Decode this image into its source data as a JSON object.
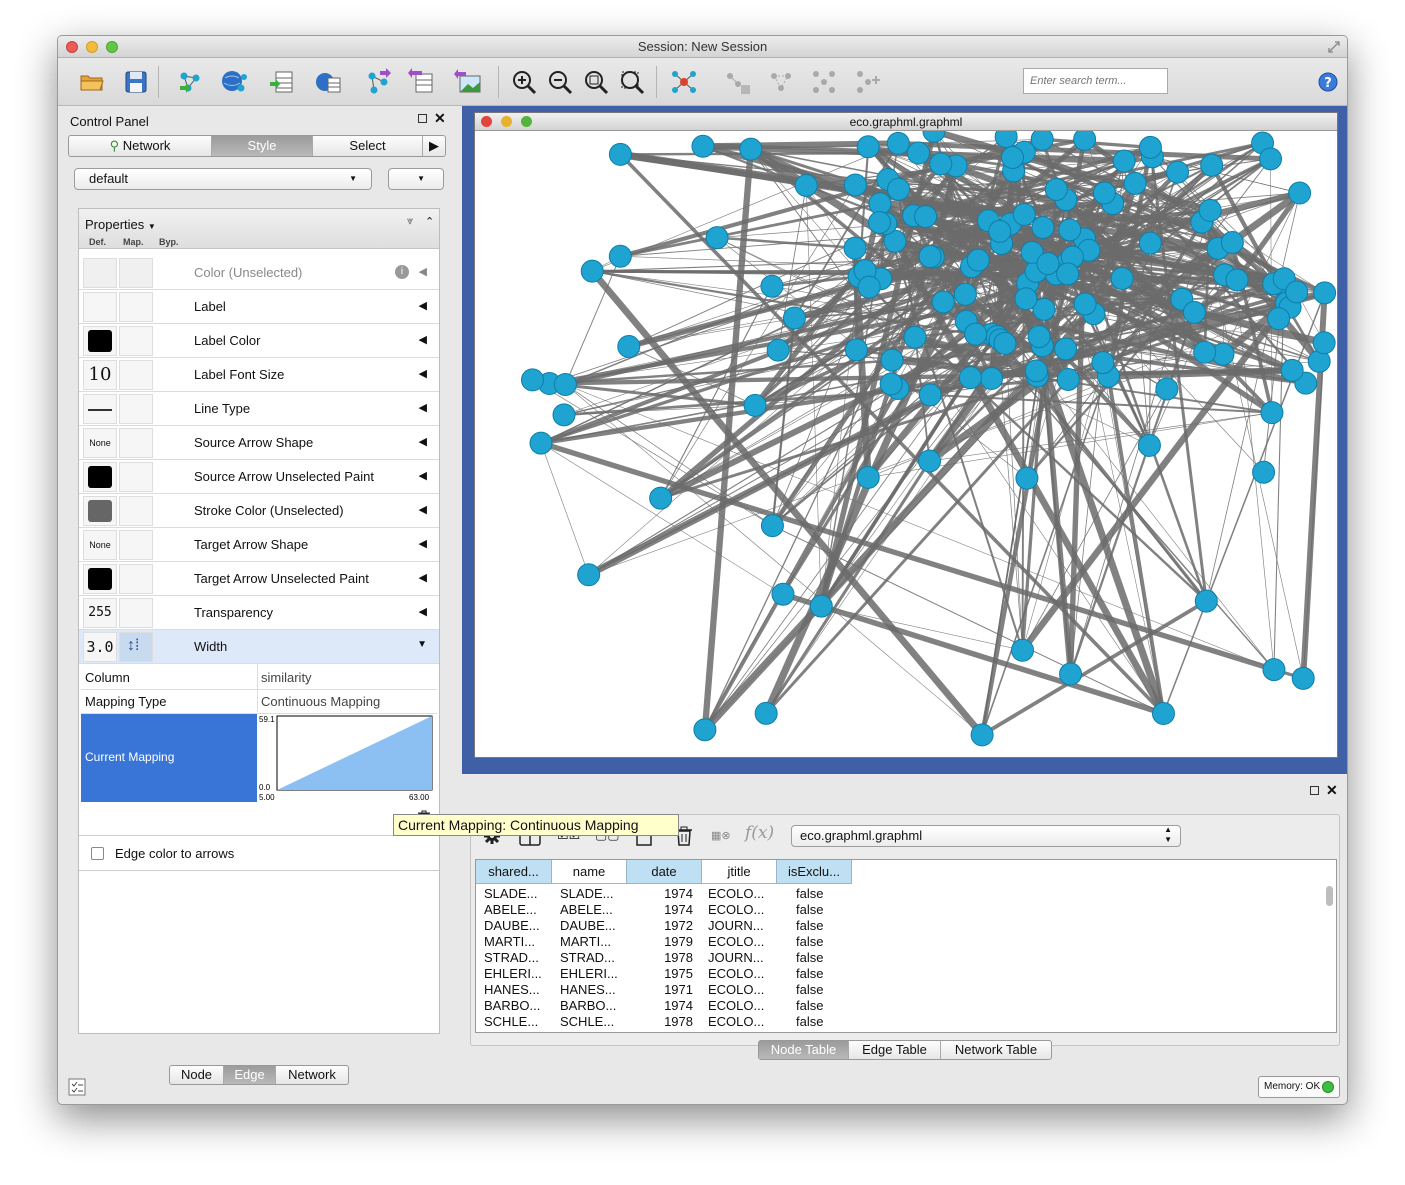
{
  "window": {
    "title": "Session: New Session"
  },
  "search": {
    "placeholder": "Enter search term..."
  },
  "control_panel": {
    "title": "Control Panel",
    "tabs": [
      "Network",
      "Style",
      "Select"
    ],
    "style_dropdown": "default",
    "properties_label": "Properties",
    "col_headers": [
      "Def.",
      "Map.",
      "Byp."
    ],
    "rows": [
      {
        "label": "Color (Unselected)",
        "def": ""
      },
      {
        "label": "Label",
        "def": ""
      },
      {
        "label": "Label Color",
        "def": ""
      },
      {
        "label": "Label Font Size",
        "def": "10"
      },
      {
        "label": "Line Type",
        "def": ""
      },
      {
        "label": "Source Arrow Shape",
        "def": "None"
      },
      {
        "label": "Source Arrow Unselected Paint",
        "def": ""
      },
      {
        "label": "Stroke Color (Unselected)",
        "def": ""
      },
      {
        "label": "Target Arrow Shape",
        "def": "None"
      },
      {
        "label": "Target Arrow Unselected Paint",
        "def": ""
      },
      {
        "label": "Transparency",
        "def": "255"
      },
      {
        "label": "Width",
        "def": "3.0"
      }
    ],
    "mapping": {
      "column_label": "Column",
      "column_value": "similarity",
      "type_label": "Mapping Type",
      "type_value": "Continuous Mapping",
      "current_label": "Current Mapping",
      "y_max": "59.1",
      "y_min": "0.0",
      "x_min": "5.00",
      "x_max": "63.00"
    },
    "edge_color_checkbox": "Edge color to arrows",
    "bottom_tabs": [
      "Node",
      "Edge",
      "Network"
    ]
  },
  "tooltip": "Current Mapping: Continuous Mapping",
  "network_view": {
    "title": "eco.graphml.graphml"
  },
  "table_panel": {
    "network_select": "eco.graphml.graphml",
    "fx_label": "f(x)",
    "columns": [
      "shared...",
      "name",
      "date",
      "jtitle",
      "isExclu..."
    ],
    "rows": [
      [
        "SLADE...",
        "SLADE...",
        "1974",
        "ECOLO...",
        "false"
      ],
      [
        "ABELE...",
        "ABELE...",
        "1974",
        "ECOLO...",
        "false"
      ],
      [
        "DAUBE...",
        "DAUBE...",
        "1972",
        "JOURN...",
        "false"
      ],
      [
        "MARTI...",
        "MARTI...",
        "1979",
        "ECOLO...",
        "false"
      ],
      [
        "STRAD...",
        "STRAD...",
        "1978",
        "JOURN...",
        "false"
      ],
      [
        "EHLERI...",
        "EHLERI...",
        "1975",
        "ECOLO...",
        "false"
      ],
      [
        "HANES...",
        "HANES...",
        "1971",
        "ECOLO...",
        "false"
      ],
      [
        "BARBO...",
        "BARBO...",
        "1974",
        "ECOLO...",
        "false"
      ],
      [
        "SCHLE...",
        "SCHLE...",
        "1978",
        "ECOLO...",
        "false"
      ]
    ],
    "bottom_tabs": [
      "Node Table",
      "Edge Table",
      "Network Table"
    ]
  },
  "status": {
    "memory": "Memory: OK"
  },
  "colors": {
    "node": "#1fa3d1",
    "edge": "#6b6b6b",
    "selected_row": "#3875d7",
    "header": "#bfe0f2",
    "network_frame": "#3f5fa6"
  }
}
